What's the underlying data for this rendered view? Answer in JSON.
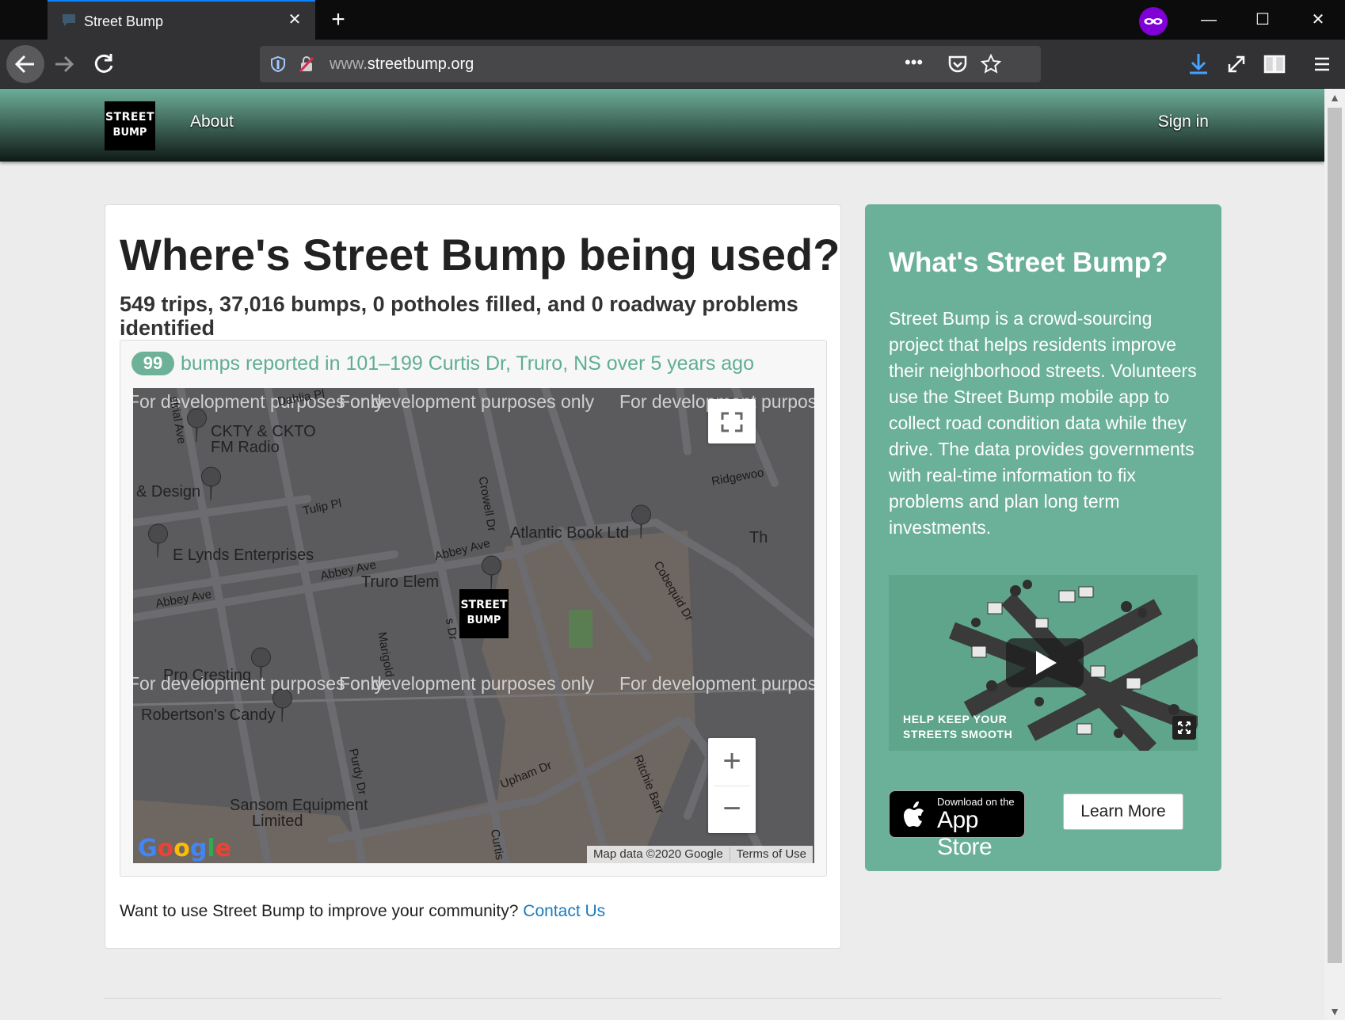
{
  "browser": {
    "tab_title": "Street Bump",
    "url_host_prefix": "www.",
    "url_host": "streetbump.org"
  },
  "header": {
    "logo_line1": "STREET",
    "logo_line2": "BUMP",
    "nav_about": "About",
    "nav_signin": "Sign in"
  },
  "main": {
    "title": "Where's Street Bump being used?",
    "stats": "549 trips, 37,016 bumps, 0 potholes filled, and 0 roadway problems identified",
    "report_count": "99",
    "report_text": "bumps reported in 101–199 Curtis Dr, Truro, NS over 5 years ago",
    "community_text": "Want to use Street Bump to improve your community?",
    "community_link": "Contact Us"
  },
  "map": {
    "watermark": "For development purposes only",
    "labels": {
      "ckty": "CKTY & CKTO",
      "ckty2": "FM Radio",
      "design": "& Design",
      "lynds": "E Lynds Enterprises",
      "truro": "Truro Elem",
      "atlantic": "Atlantic Book Ltd",
      "cresting": "Pro Cresting",
      "candy": "Robertson's Candy",
      "sansom": "Sansom Equipment",
      "sansom2": "Limited",
      "tulip": "Tulip Pl",
      "abbey1": "Abbey Ave",
      "abbey2": "Abbey Ave",
      "abbey3": "Abbey Ave",
      "crowell": "Crowell Dr",
      "cobequid": "Cobequid Dr",
      "marigold": "Marigold",
      "purdy": "Purdy Dr",
      "upham": "Upham Dr",
      "ritchie": "Ritchie Barr",
      "ridgewood": "Ridgewoo",
      "dahlia": "Dahlia Pl",
      "industrial": "strial Ave",
      "th": "Th",
      "curtis": "Curtis",
      "sdr": "s Dr"
    },
    "attribution_data": "Map data ©2020 Google",
    "attribution_terms": "Terms of Use",
    "google_logo": "Google",
    "zoom_in": "+",
    "zoom_out": "−"
  },
  "sidebar": {
    "title": "What's Street Bump?",
    "description": "Street Bump is a crowd-sourcing project that helps residents improve their neighborhood streets. Volunteers use the Street Bump mobile app to collect road condition data while they drive. The data provides governments with real-time information to fix problems and plan long term investments.",
    "video_caption_1": "HELP KEEP YOUR",
    "video_caption_2": "STREETS SMOOTH",
    "appstore_small": "Download on the",
    "appstore_big": "App Store",
    "learn_more": "Learn More"
  },
  "colors": {
    "accent_green": "#6bb098",
    "link_blue": "#1a7bbf",
    "private_purple": "#8000d7"
  }
}
